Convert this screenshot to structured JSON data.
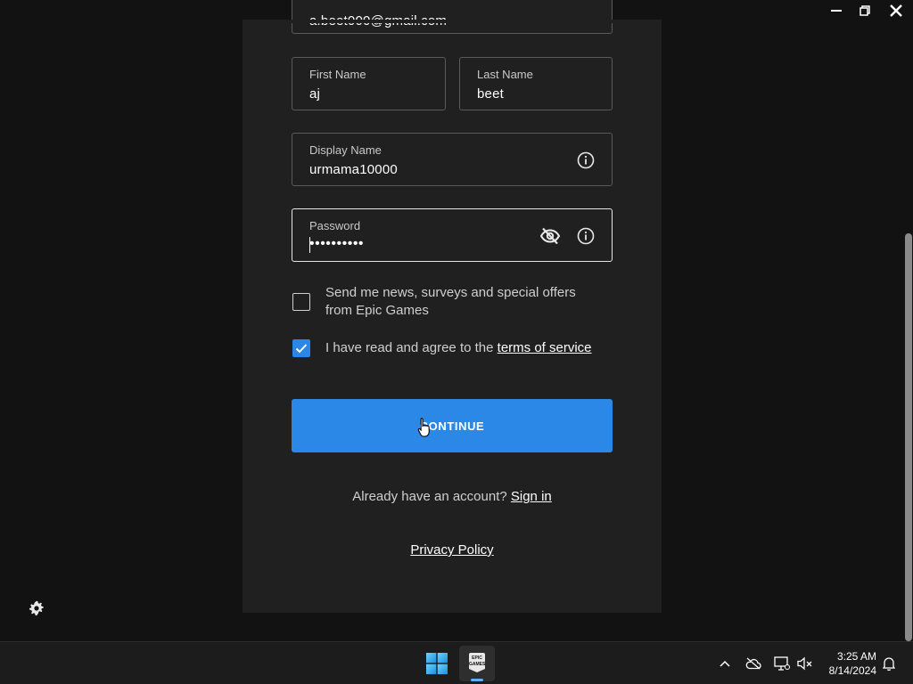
{
  "form": {
    "email": {
      "value": "a.beet000@gmail.com"
    },
    "first_name": {
      "label": "First Name",
      "value": "aj"
    },
    "last_name": {
      "label": "Last Name",
      "value": "beet"
    },
    "display_name": {
      "label": "Display Name",
      "value": "urmama10000"
    },
    "password": {
      "label": "Password",
      "value": "••••••••••"
    },
    "news_checkbox": {
      "checked": false,
      "line1": "Send me news, surveys and special offers",
      "line2": "from Epic Games"
    },
    "tos_checkbox": {
      "checked": true,
      "text": "I have read and agree to the ",
      "link": "terms of service"
    },
    "continue_label": "CONTINUE",
    "signin_prompt": "Already have an account? ",
    "signin_link": "Sign in",
    "privacy_link": "Privacy Policy"
  },
  "taskbar": {
    "time": "3:25 AM",
    "date": "8/14/2024",
    "epic_logo_text": "EPIC GAMES"
  },
  "colors": {
    "accent": "#2b88e7",
    "panel": "#202020",
    "background": "#121212"
  }
}
